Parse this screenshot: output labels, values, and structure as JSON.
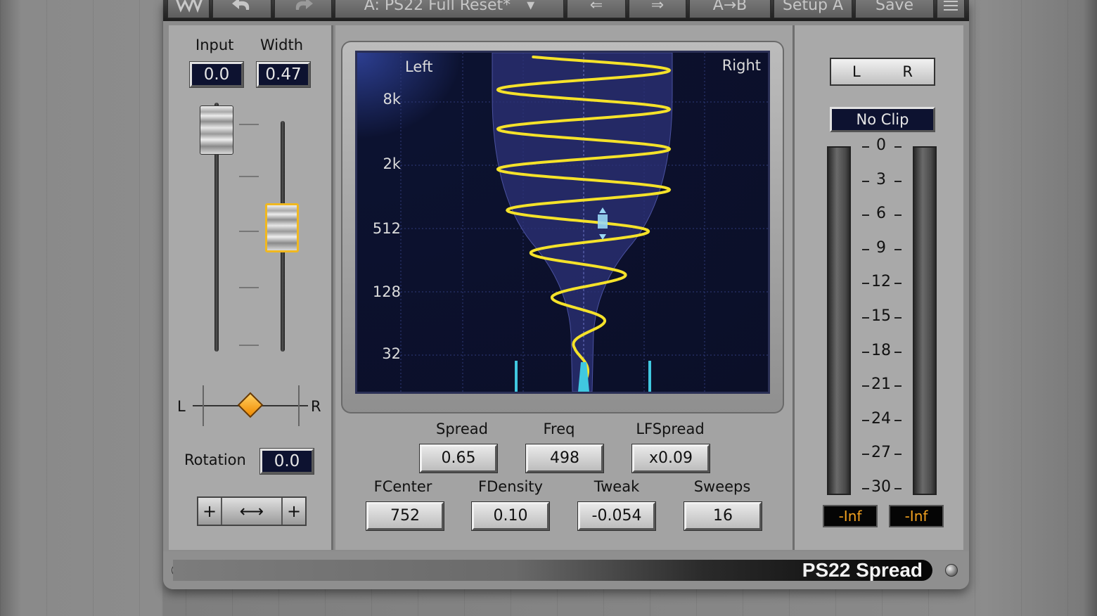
{
  "toolbar": {
    "undo_icon": "undo-icon",
    "redo_icon": "redo-icon",
    "preset_name": "A: PS22 Full Reset*",
    "preset_menu": "▾",
    "prev_label": "⇐",
    "next_label": "⇒",
    "compare_label": "A→B",
    "setup_label": "Setup A",
    "save_label": "Save",
    "menu_icon": "menu-icon"
  },
  "left": {
    "input_label": "Input",
    "width_label": "Width",
    "input_value": "0.0",
    "width_value": "0.47",
    "input_level": 0.95,
    "width_level": 0.47,
    "balance_left": "L",
    "balance_right": "R",
    "rotation_label": "Rotation",
    "rotation_value": "0.0",
    "stepper_minus": "+",
    "stepper_arrow": "⟷",
    "stepper_plus": "+"
  },
  "display": {
    "left_label": "Left",
    "right_label": "Right",
    "freq_labels": [
      "8k",
      "2k",
      "512",
      "128",
      "32"
    ]
  },
  "params": {
    "spread_label": "Spread",
    "spread_value": "0.65",
    "freq_label": "Freq",
    "freq_value": "498",
    "lfspread_label": "LFSpread",
    "lfspread_value": "x0.09",
    "fcenter_label": "FCenter",
    "fcenter_value": "752",
    "fdensity_label": "FDensity",
    "fdensity_value": "0.10",
    "tweak_label": "Tweak",
    "tweak_value": "-0.054",
    "sweeps_label": "Sweeps",
    "sweeps_value": "16"
  },
  "right": {
    "lr_left": "L",
    "lr_right": "R",
    "noclip_label": "No Clip",
    "meter_scale": [
      "0",
      "3",
      "6",
      "9",
      "12",
      "15",
      "18",
      "21",
      "24",
      "27",
      "30"
    ],
    "left_peak": "-Inf",
    "right_peak": "-Inf"
  },
  "footer": {
    "product_name": "PS22 Spread"
  },
  "colors": {
    "accent_orange": "#f0a020",
    "curve_yellow": "#f5e22a",
    "display_bg": "#0b0f28",
    "selected_outline": "#f0b820"
  }
}
